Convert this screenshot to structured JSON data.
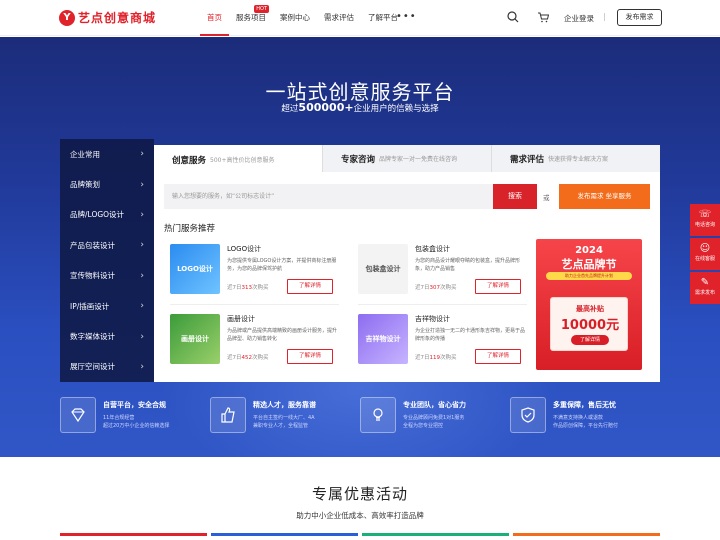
{
  "brand": {
    "mark": "Y",
    "name": "艺点创意商城"
  },
  "nav": {
    "items": [
      {
        "label": "首页"
      },
      {
        "label": "服务项目",
        "badge": "HOT"
      },
      {
        "label": "案例中心"
      },
      {
        "label": "需求评估"
      },
      {
        "label": "了解平台"
      }
    ],
    "more": "•••",
    "login": "企业登录",
    "separator": "|",
    "publish": "发布需求"
  },
  "hero": {
    "title": "一站式创意服务平台",
    "sub_pre": "超过",
    "sub_num": "500000+",
    "sub_post": "企业用户的信赖与选择"
  },
  "categories": [
    "企业常用",
    "品牌策划",
    "品牌/LOGO设计",
    "产品包装设计",
    "宣传物料设计",
    "IP/插画设计",
    "数字媒体设计",
    "展厅空间设计"
  ],
  "tabs": [
    {
      "title": "创意服务",
      "desc": "500+高性价比创意服务"
    },
    {
      "title": "专家咨询",
      "desc": "品牌专家一对一免费在线咨询"
    },
    {
      "title": "需求评估",
      "desc": "快速获得专业解决方案"
    }
  ],
  "search": {
    "placeholder": "输入您想要的服务，如“公司标志设计”",
    "button": "搜索",
    "or": "或",
    "request_button": "发布需求 坐享服务"
  },
  "recommend": {
    "title": "热门服务推荐",
    "cards": [
      {
        "name": "LOGO设计",
        "desc": "为您提供专属LOGO设计方案，并提供商标注册服务，为您的品牌保驾护航",
        "sold_pre": "近7日",
        "sold_num": "313",
        "sold_post": "次购买",
        "button": "了解详情",
        "thumb": "LOGO设计"
      },
      {
        "name": "包装盒设计",
        "desc": "为您的商品设计耀眼夺睛的包装盒，提升品牌形象，助力产品销售",
        "sold_pre": "近7日",
        "sold_num": "307",
        "sold_post": "次购买",
        "button": "了解详情",
        "thumb": "包装盒设计"
      },
      {
        "name": "画册设计",
        "desc": "为品牌或产品提供高端精致的画册设计服务，提升品牌型、助力销售转化",
        "sold_pre": "近7日",
        "sold_num": "452",
        "sold_post": "次购买",
        "button": "了解详情",
        "thumb": "画册设计"
      },
      {
        "name": "吉祥物设计",
        "desc": "为企业打造独一无二的卡通形象吉祥物，更易于品牌形象的传播",
        "sold_pre": "近7日",
        "sold_num": "119",
        "sold_post": "次购买",
        "button": "了解详情",
        "thumb": "吉祥物设计"
      }
    ]
  },
  "promo": {
    "year": "2024",
    "name": "艺点品牌节",
    "tag": "助力企业首先品牌提升计划",
    "label": "最高补贴",
    "amount": "10000元",
    "button": "了解详情"
  },
  "features": [
    {
      "title": "自营平台，安全合规",
      "desc": "11年合规经营\n超过20万中小企业的信赖选择"
    },
    {
      "title": "精选人才，服务靠谱",
      "desc": "平台自主签约一线大厂、4A\n兼职专业人才，全程监管"
    },
    {
      "title": "专业团队，省心省力",
      "desc": "专业品牌顾问免费1对1服务\n全程为您专业把控"
    },
    {
      "title": "多重保障，售后无忧",
      "desc": "不满意支持换人或退款\n作品原创保障，平台先行赔付"
    }
  ],
  "sidebar": [
    {
      "icon": "☏",
      "label": "电话咨询"
    },
    {
      "icon": "☺",
      "label": "在线客服"
    },
    {
      "icon": "✎",
      "label": "需求发布"
    }
  ],
  "section": {
    "title": "专属优惠活动",
    "subtitle": "助力中小企业低成本、高效率打造品牌"
  },
  "colors": {
    "brand_red": "#e0222b",
    "orange": "#f26c1b",
    "hero_blue": "#213a9a"
  }
}
